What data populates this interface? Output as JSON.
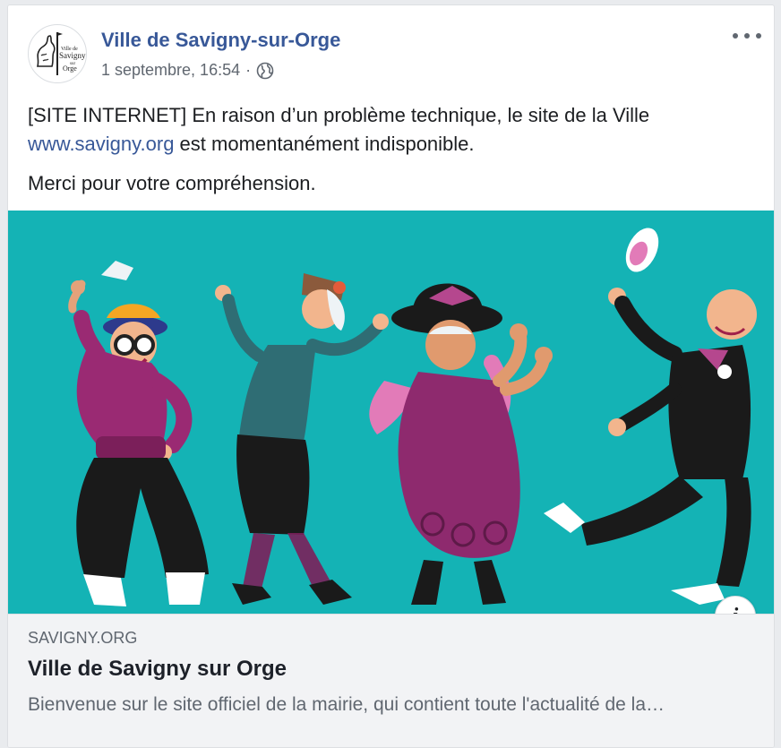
{
  "post": {
    "page_name": "Ville de Savigny-sur-Orge",
    "timestamp": "1 septembre, 16:54",
    "separator": "·",
    "privacy_icon": "globe-icon",
    "more_icon": "more-options-icon",
    "avatar_logo": {
      "line1": "Ville de",
      "line2": "Savigny",
      "line3": "sur",
      "line4": "Orge"
    },
    "text_line1_before": "[SITE INTERNET] En raison d’un problème technique, le site de la Ville",
    "text_link": "www.savigny.org",
    "text_line1_after": " est momentanément indisponible.",
    "text_line2": "Merci pour votre compréhension."
  },
  "image": {
    "background_color": "#14b3b5",
    "description_icon": "dancing-seniors-illustration"
  },
  "info_button": {
    "label": "i",
    "icon": "info-icon"
  },
  "link_preview": {
    "domain": "SAVIGNY.ORG",
    "title": "Ville de Savigny sur Orge",
    "description": "Bienvenue sur le site officiel de la mairie, qui contient toute l'actualité de la…"
  },
  "colors": {
    "link": "#385898",
    "text": "#1c1e21",
    "secondary": "#606770",
    "preview_bg": "#f2f3f5"
  }
}
